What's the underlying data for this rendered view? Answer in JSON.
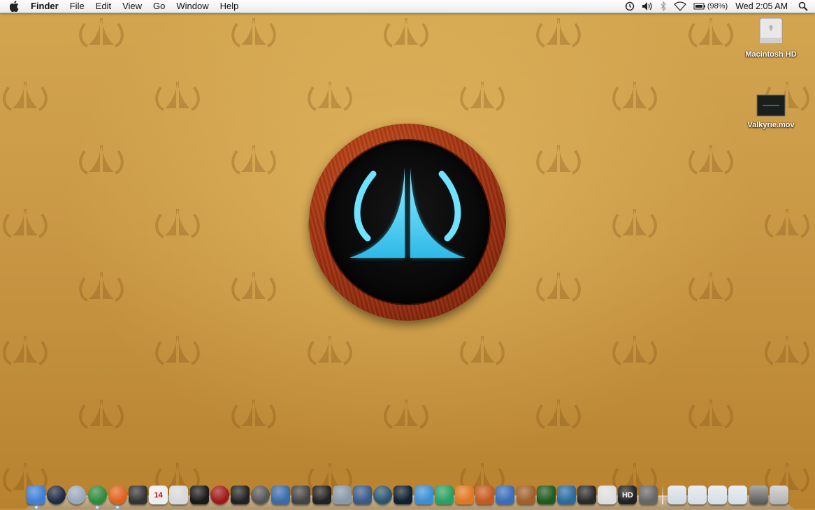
{
  "menubar": {
    "app_name": "Finder",
    "menus": [
      "File",
      "Edit",
      "View",
      "Go",
      "Window",
      "Help"
    ],
    "battery_percent": "(98%)",
    "clock": "Wed 2:05 AM",
    "status_icons": [
      "time-machine-icon",
      "volume-icon",
      "bluetooth-icon",
      "wifi-icon",
      "battery-icon",
      "spotlight-icon"
    ]
  },
  "desktop": {
    "icons": [
      {
        "label": "Macintosh HD",
        "icon": "hard-drive-icon"
      },
      {
        "label": "Valkyrie.mov",
        "icon": "movie-file-icon"
      }
    ],
    "wallpaper": {
      "base_color": "#c99845",
      "logo_glow_color": "#5fe0ff",
      "logo_ring_color": "#a8381a"
    }
  },
  "dock": {
    "calendar_day": "14",
    "hd_badge": "HD",
    "apps": [
      {
        "icon": "finder-icon",
        "color": "#3d7fd6"
      },
      {
        "icon": "dashboard-icon",
        "color": "#1f2a44"
      },
      {
        "icon": "safari-icon",
        "color": "#9aa9b8"
      },
      {
        "icon": "globe-icon",
        "color": "#2f8a3c"
      },
      {
        "icon": "firefox-icon",
        "color": "#e0621a"
      },
      {
        "icon": "ichat-icon",
        "color": "#333333"
      },
      {
        "icon": "ical-icon",
        "color": "#eeeeee"
      },
      {
        "icon": "textedit-icon",
        "color": "#d8d8d8"
      },
      {
        "icon": "display-icon",
        "color": "#1a1a1a"
      },
      {
        "icon": "dvd-player-icon",
        "color": "#a01818"
      },
      {
        "icon": "imovie-icon",
        "color": "#222222"
      },
      {
        "icon": "itunes-icon",
        "color": "#555555"
      },
      {
        "icon": "iphoto-icon",
        "color": "#3b6aa8"
      },
      {
        "icon": "final-cut-icon",
        "color": "#444444"
      },
      {
        "icon": "clapper-icon",
        "color": "#222222"
      },
      {
        "icon": "xcode-icon",
        "color": "#8899aa"
      },
      {
        "icon": "directory-utility-icon",
        "color": "#3a5a8a"
      },
      {
        "icon": "time-machine-icon",
        "color": "#2a5570"
      },
      {
        "icon": "telescope-icon",
        "color": "#102030"
      },
      {
        "icon": "wordpress-icon",
        "color": "#3c8fd4"
      },
      {
        "icon": "cyberduck-icon",
        "color": "#2aa060"
      },
      {
        "icon": "pages-icon",
        "color": "#e07820"
      },
      {
        "icon": "keynote-icon",
        "color": "#c55a20"
      },
      {
        "icon": "robot-icon",
        "color": "#3a6cb8"
      },
      {
        "icon": "pot-icon",
        "color": "#a0602a"
      },
      {
        "icon": "star-app-icon",
        "color": "#1f5a1f"
      },
      {
        "icon": "game-icon",
        "color": "#2a6aa0"
      },
      {
        "icon": "pirate-icon",
        "color": "#2a2a2a"
      },
      {
        "icon": "stormtrooper-icon",
        "color": "#dddddd"
      },
      {
        "icon": "hd-icon",
        "color": "#222222"
      },
      {
        "icon": "system-preferences-icon",
        "color": "#666666"
      }
    ],
    "stacks": [
      {
        "icon": "applications-stack-icon",
        "color": "#cfd8e0"
      },
      {
        "icon": "documents-stack-icon",
        "color": "#d5dde5"
      },
      {
        "icon": "downloads-stack-icon",
        "color": "#d5dde5"
      },
      {
        "icon": "folder-stack-icon",
        "color": "#d5dde5"
      },
      {
        "icon": "screenshots-stack-icon",
        "color": "#555555"
      },
      {
        "icon": "trash-icon",
        "color": "#b0b0b0"
      }
    ]
  }
}
